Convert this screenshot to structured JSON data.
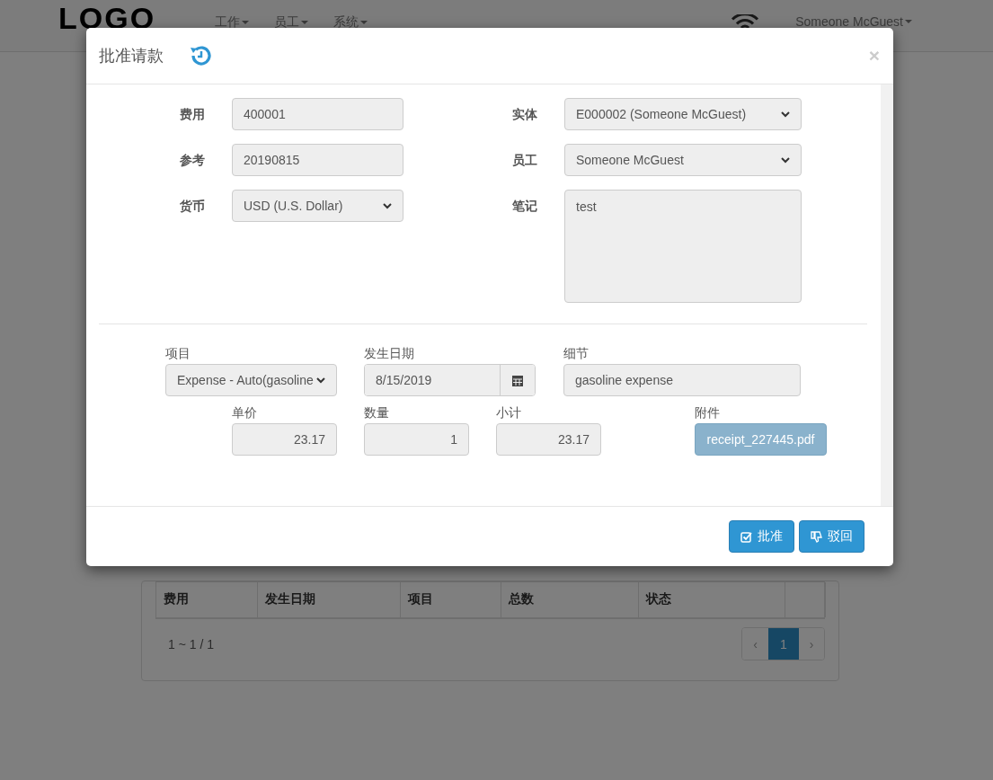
{
  "navbar": {
    "logo": "LOGO",
    "menus": [
      {
        "label": "工作"
      },
      {
        "label": "员工"
      },
      {
        "label": "系统"
      }
    ],
    "user": "Someone McGuest"
  },
  "modal": {
    "title": "批准请款",
    "close": "×",
    "fields_left": [
      {
        "label": "费用",
        "kind": "input",
        "value": "400001"
      },
      {
        "label": "参考",
        "kind": "input",
        "value": "20190815"
      },
      {
        "label": "货币",
        "kind": "select",
        "value": "USD (U.S. Dollar)"
      }
    ],
    "fields_right": [
      {
        "label": "实体",
        "kind": "select",
        "value": "E000002 (Someone McGuest)"
      },
      {
        "label": "员工",
        "kind": "select",
        "value": "Someone McGuest"
      },
      {
        "label": "笔记",
        "kind": "textarea",
        "value": "test"
      }
    ],
    "line": {
      "item": {
        "label": "项目",
        "value": "Expense - Auto(gasoline"
      },
      "date": {
        "label": "发生日期",
        "value": "8/15/2019"
      },
      "detail": {
        "label": "细节",
        "value": "gasoline expense"
      },
      "price": {
        "label": "单价",
        "value": "23.17"
      },
      "quantity": {
        "label": "数量",
        "value": "1"
      },
      "subtotal": {
        "label": "小计",
        "value": "23.17"
      },
      "attachment": {
        "label": "附件",
        "value": "receipt_227445.pdf"
      }
    },
    "buttons": [
      {
        "label": "批准",
        "kind": "approve"
      },
      {
        "label": "驳回",
        "kind": "reject"
      }
    ]
  },
  "table": {
    "columns": [
      "费用",
      "发生日期",
      "项目",
      "总数",
      "状态"
    ]
  },
  "pagination": {
    "summary": "1 ~ 1 / 1",
    "prev": "‹",
    "next": "›",
    "pages": [
      {
        "label": "1",
        "selected": true
      }
    ]
  }
}
